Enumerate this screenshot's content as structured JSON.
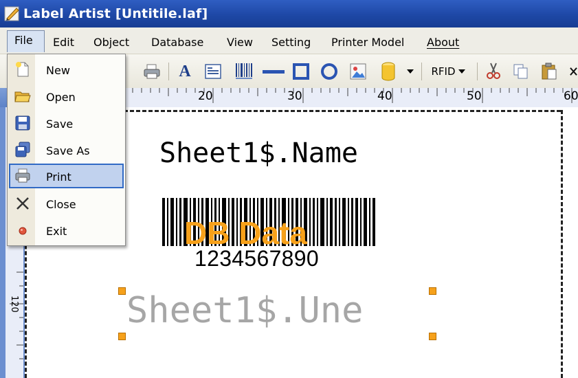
{
  "window": {
    "title": "Label Artist [Untitile.laf]"
  },
  "menubar": {
    "items": [
      "File",
      "Edit",
      "Object",
      "Database",
      "View",
      "Setting",
      "Printer Model",
      "About"
    ]
  },
  "file_menu": {
    "items": [
      {
        "label": "New",
        "icon": "new-file-icon"
      },
      {
        "label": "Open",
        "icon": "open-folder-icon"
      },
      {
        "label": "Save",
        "icon": "save-disk-icon"
      },
      {
        "label": "Save As",
        "icon": "save-as-icon"
      },
      {
        "label": "Print",
        "icon": "printer-icon",
        "selected": true
      },
      {
        "label": "Close",
        "icon": "close-x-icon"
      },
      {
        "label": "Exit",
        "icon": "exit-dot-icon"
      }
    ]
  },
  "toolbar": {
    "text_tool": "A",
    "rfid_label": "RFID"
  },
  "ruler": {
    "marks": [
      "20",
      "30",
      "40",
      "50",
      "60"
    ],
    "vertical_mark": "120"
  },
  "canvas": {
    "field_name": "Sheet1$.Name",
    "barcode_overlay": "DB Data",
    "barcode_digits": "1234567890",
    "field_une": "Sheet1$.Une"
  },
  "colors": {
    "titlebar": "#1e48a6",
    "accent_orange": "#f7a11a",
    "menu_selected": "#c1d2ee"
  }
}
